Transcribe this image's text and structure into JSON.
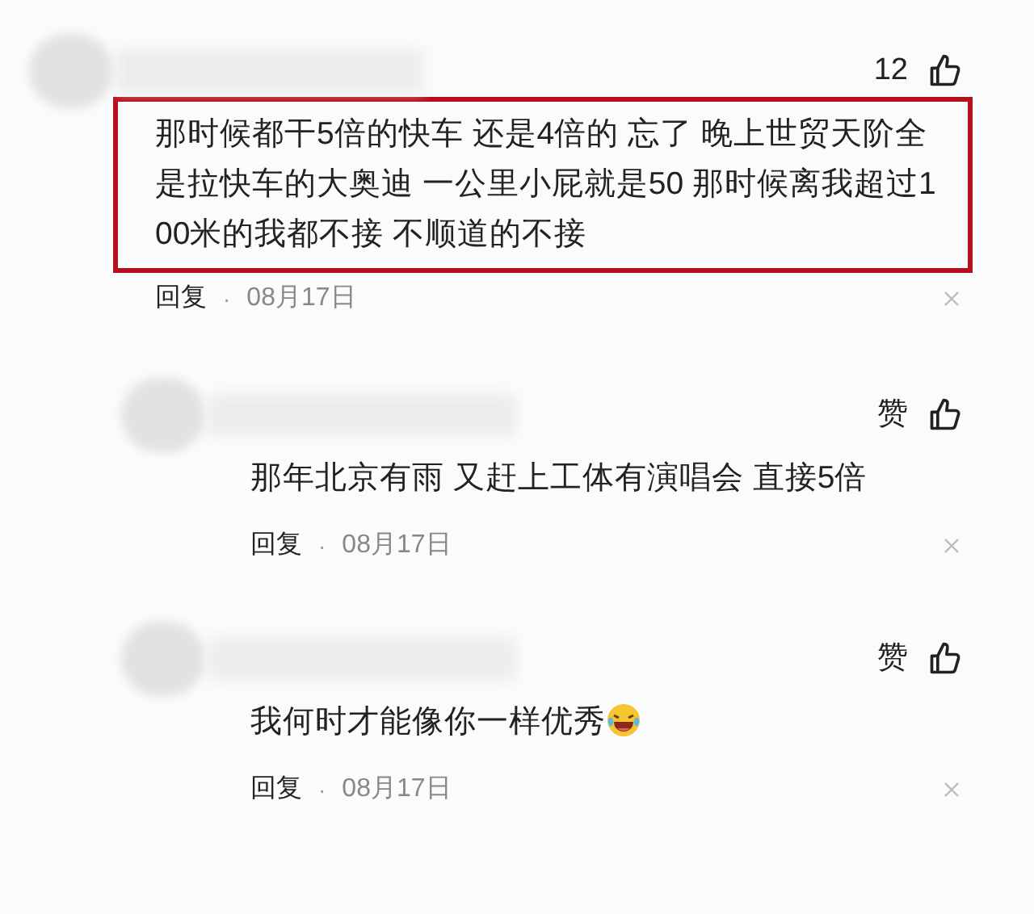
{
  "comments": [
    {
      "kind": "top",
      "likes": "12",
      "highlighted": true,
      "text": "那时候都干5倍的快车 还是4倍的 忘了 晚上世贸天阶全是拉快车的大奥迪 一公里小屁就是50 那时候离我超过100米的我都不接 不顺道的不接",
      "emoji": false,
      "reply": "回复",
      "separator": "·",
      "date": "08月17日"
    },
    {
      "kind": "reply",
      "likes": "赞",
      "highlighted": false,
      "text": "那年北京有雨 又赶上工体有演唱会 直接5倍",
      "emoji": false,
      "reply": "回复",
      "separator": "·",
      "date": "08月17日"
    },
    {
      "kind": "reply",
      "likes": "赞",
      "highlighted": false,
      "text": "我何时才能像你一样优秀",
      "emoji": true,
      "reply": "回复",
      "separator": "·",
      "date": "08月17日"
    }
  ]
}
